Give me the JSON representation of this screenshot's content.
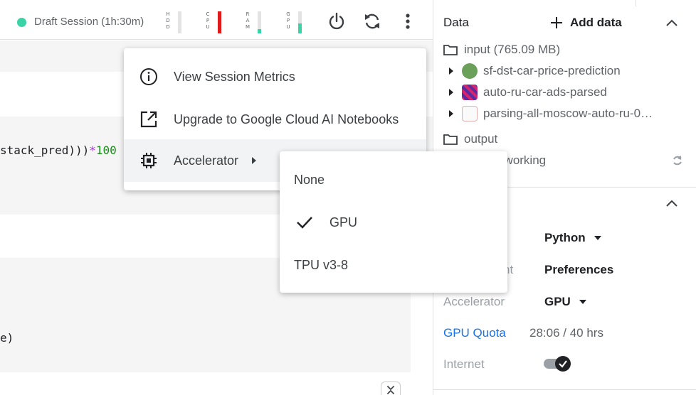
{
  "toolbar": {
    "session_label": "Draft Session (1h:30m)",
    "status_color": "#3ad3a5",
    "meters": [
      {
        "tag": "H\nD\nD",
        "level": 0.0,
        "color": "#e3e3e3"
      },
      {
        "tag": "C\nP\nU",
        "level": 1.0,
        "color": "#e0191c"
      },
      {
        "tag": "R\nA\nM",
        "level": 0.2,
        "color": "#3ad3a5"
      },
      {
        "tag": "G\nP\nU",
        "level": 0.45,
        "color": "#3ad3a5"
      }
    ]
  },
  "editor": {
    "line1_text": "stack_pred)))",
    "line1_op": "*",
    "line1_num": "100",
    "line2_text": "e)"
  },
  "context_menu": {
    "items": [
      {
        "label": "View Session Metrics",
        "icon": "info-icon"
      },
      {
        "label": "Upgrade to Google Cloud AI Notebooks",
        "icon": "open-external-icon"
      },
      {
        "label": "Accelerator",
        "icon": "chip-icon"
      }
    ],
    "accelerator_submenu": {
      "options": [
        "None",
        "GPU",
        "TPU v3-8"
      ],
      "selected": "GPU"
    }
  },
  "panel": {
    "title": "Data",
    "add_data_label": "Add data",
    "input_folder": "input (765.09 MB)",
    "datasets": [
      "sf-dst-car-price-prediction",
      "auto-ru-car-ads-parsed",
      "parsing-all-moscow-auto-ru-0…"
    ],
    "output_folder": "output",
    "working_path": "/kaggle/working",
    "settings": {
      "language_value": "Python",
      "environment_label_partial": "nt",
      "environment_value": "Preferences",
      "accelerator_label": "Accelerator",
      "accelerator_value": "GPU",
      "gpu_quota_label": "GPU Quota",
      "gpu_quota_value": "28:06 / 40 hrs",
      "internet_label": "Internet",
      "internet_on": true
    }
  }
}
